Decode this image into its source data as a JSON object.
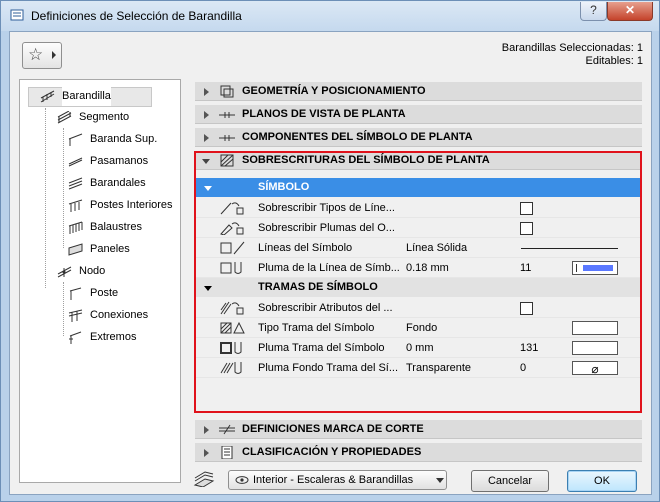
{
  "window": {
    "title": "Definiciones de Selección de Barandilla",
    "help_label": "?",
    "close_label": "✕"
  },
  "selection_info": {
    "selected": "Barandillas Seleccionadas: 1",
    "editable": "Editables: 1"
  },
  "tree": {
    "items": [
      {
        "label": "Barandilla",
        "icon": "railing-icon"
      },
      {
        "label": "Segmento",
        "icon": "segment-icon"
      },
      {
        "label": "Baranda Sup.",
        "icon": "top-rail-icon"
      },
      {
        "label": "Pasamanos",
        "icon": "handrail-icon"
      },
      {
        "label": "Barandales",
        "icon": "rails-icon"
      },
      {
        "label": "Postes Interiores",
        "icon": "inner-posts-icon"
      },
      {
        "label": "Balaustres",
        "icon": "balusters-icon"
      },
      {
        "label": "Paneles",
        "icon": "panels-icon"
      },
      {
        "label": "Nodo",
        "icon": "node-icon"
      },
      {
        "label": "Poste",
        "icon": "post-icon"
      },
      {
        "label": "Conexiones",
        "icon": "connections-icon"
      },
      {
        "label": "Extremos",
        "icon": "ends-icon"
      }
    ]
  },
  "sections": {
    "geometry": "GEOMETRÍA Y POSICIONAMIENTO",
    "floor_plan_views": "PLANOS DE VISTA DE PLANTA",
    "symbol_components": "COMPONENTES DEL SÍMBOLO DE PLANTA",
    "symbol_overrides": "SOBRESCRITURAS DEL SÍMBOLO DE PLANTA",
    "cut_marker": "DEFINICIONES MARCA DE CORTE",
    "classification": "CLASIFICACIÓN Y PROPIEDADES"
  },
  "symbol_group": {
    "title": "SÍMBOLO",
    "rows": {
      "override_line_types": {
        "label": "Sobrescribir Tipos de Líne..."
      },
      "override_pens": {
        "label": "Sobrescribir Plumas del O..."
      },
      "symbol_lines": {
        "label": "Líneas del Símbolo",
        "value": "Línea Sólida"
      },
      "symbol_line_pen": {
        "label": "Pluma de la Línea de Símb...",
        "value": "0.18 mm",
        "number": "11",
        "swatch_color": "#5a78ff"
      }
    }
  },
  "hatch_group": {
    "title": "TRAMAS DE SÍMBOLO",
    "rows": {
      "override_attributes": {
        "label": "Sobrescribir Atributos del ..."
      },
      "hatch_type": {
        "label": "Tipo Trama del Símbolo",
        "value": "Fondo"
      },
      "hatch_pen": {
        "label": "Pluma Trama del Símbolo",
        "value": "0 mm",
        "number": "131"
      },
      "hatch_bg_pen": {
        "label": "Pluma Fondo Trama del Sí...",
        "value": "Transparente",
        "number": "0",
        "swatch_symbol": "⌀"
      }
    }
  },
  "footer": {
    "favorite_view": "Interior - Escaleras & Barandillas",
    "cancel_label": "Cancelar",
    "ok_label": "OK"
  }
}
